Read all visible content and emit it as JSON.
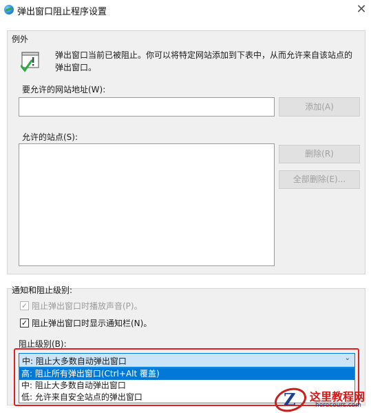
{
  "window": {
    "title": "弹出窗口阻止程序设置",
    "close_glyph": "✕"
  },
  "exceptions": {
    "group_title": "例外",
    "info_text": "弹出窗口当前已被阻止。你可以将特定网站添加到下表中，从而允许来自该站点的弹出窗口。",
    "address_label": "要允许的网站地址(W):",
    "address_value": "",
    "add_button": "添加(A)",
    "allowed_label": "允许的站点(S):",
    "allowed_sites": [],
    "remove_button": "删除(R)",
    "remove_all_button": "全部删除(E)..."
  },
  "notifications": {
    "group_title": "通知和阻止级别:",
    "play_sound": {
      "label": "阻止弹出窗口时播放声音(P)。",
      "checked": true,
      "enabled": false
    },
    "show_bar": {
      "label": "阻止弹出窗口时显示通知栏(N)。",
      "checked": true,
      "enabled": true
    },
    "block_level_label": "阻止级别(B):",
    "block_level_selected": "中: 阻止大多数自动弹出窗口",
    "dropdown_arrow": "⌄",
    "options": [
      {
        "label": "高: 阻止所有弹出窗口(Ctrl+Alt 覆盖)",
        "highlighted": true
      },
      {
        "label": "中: 阻止大多数自动弹出窗口",
        "highlighted": false
      },
      {
        "label": "低: 允许来自安全站点的弹出窗口",
        "highlighted": false
      }
    ]
  },
  "watermark": {
    "text": "这里教程网",
    "url": "herecours.com"
  },
  "colors": {
    "accent": "#0078d7",
    "highlight_border": "#e02020",
    "watermark": "#d21a1a"
  }
}
